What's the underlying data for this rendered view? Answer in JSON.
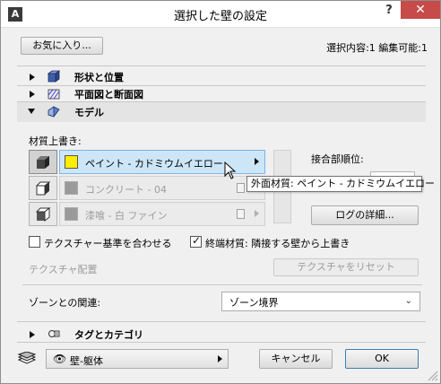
{
  "window": {
    "title": "選択した壁の設定",
    "help_label": "?",
    "close_label": "✕"
  },
  "header": {
    "favorites_label": "お気に入り...",
    "selection_info": "選択内容:1 編集可能:1"
  },
  "sections": {
    "shape": {
      "label": "形状と位置",
      "icon": "wall-box-icon"
    },
    "plan": {
      "label": "平面図と断面図",
      "icon": "hatch-plan-icon"
    },
    "model": {
      "label": "モデル",
      "icon": "model-wedge-icon"
    },
    "tags": {
      "label": "タグとカテゴリ",
      "icon": "tag-category-icon"
    }
  },
  "materials": {
    "override_label": "材質上書き:",
    "rows": [
      {
        "name": "ペイント - カドミウムイエロー",
        "color": "#ffee00",
        "active": true
      },
      {
        "name": "コンクリート - 04",
        "color": "#9a9a9a",
        "active": false
      },
      {
        "name": "漆喰 - 白 ファイン",
        "color": "#9a9a9a",
        "active": false
      }
    ],
    "priority_label": "接合部順位:",
    "tooltip": "外面材質: ペイント - カドミウムイエロー",
    "log_button": "ログの詳細..."
  },
  "texture": {
    "align_label": "テクスチャー基準を合わせる",
    "align_checked": false,
    "end_label": "終端材質: 隣接する壁から上書き",
    "end_checked": true,
    "placement_label": "テクスチャ配置",
    "reset_button": "テクスチャをリセット"
  },
  "zone": {
    "label": "ゾーンとの関連:",
    "value": "ゾーン境界"
  },
  "footer": {
    "layer_value": "壁-躯体",
    "cancel_label": "キャンセル",
    "ok_label": "OK"
  },
  "colors": {
    "close_button": "#c74b49",
    "selection_highlight": "#cde6f7",
    "active_material_swatch": "#ffee00"
  }
}
